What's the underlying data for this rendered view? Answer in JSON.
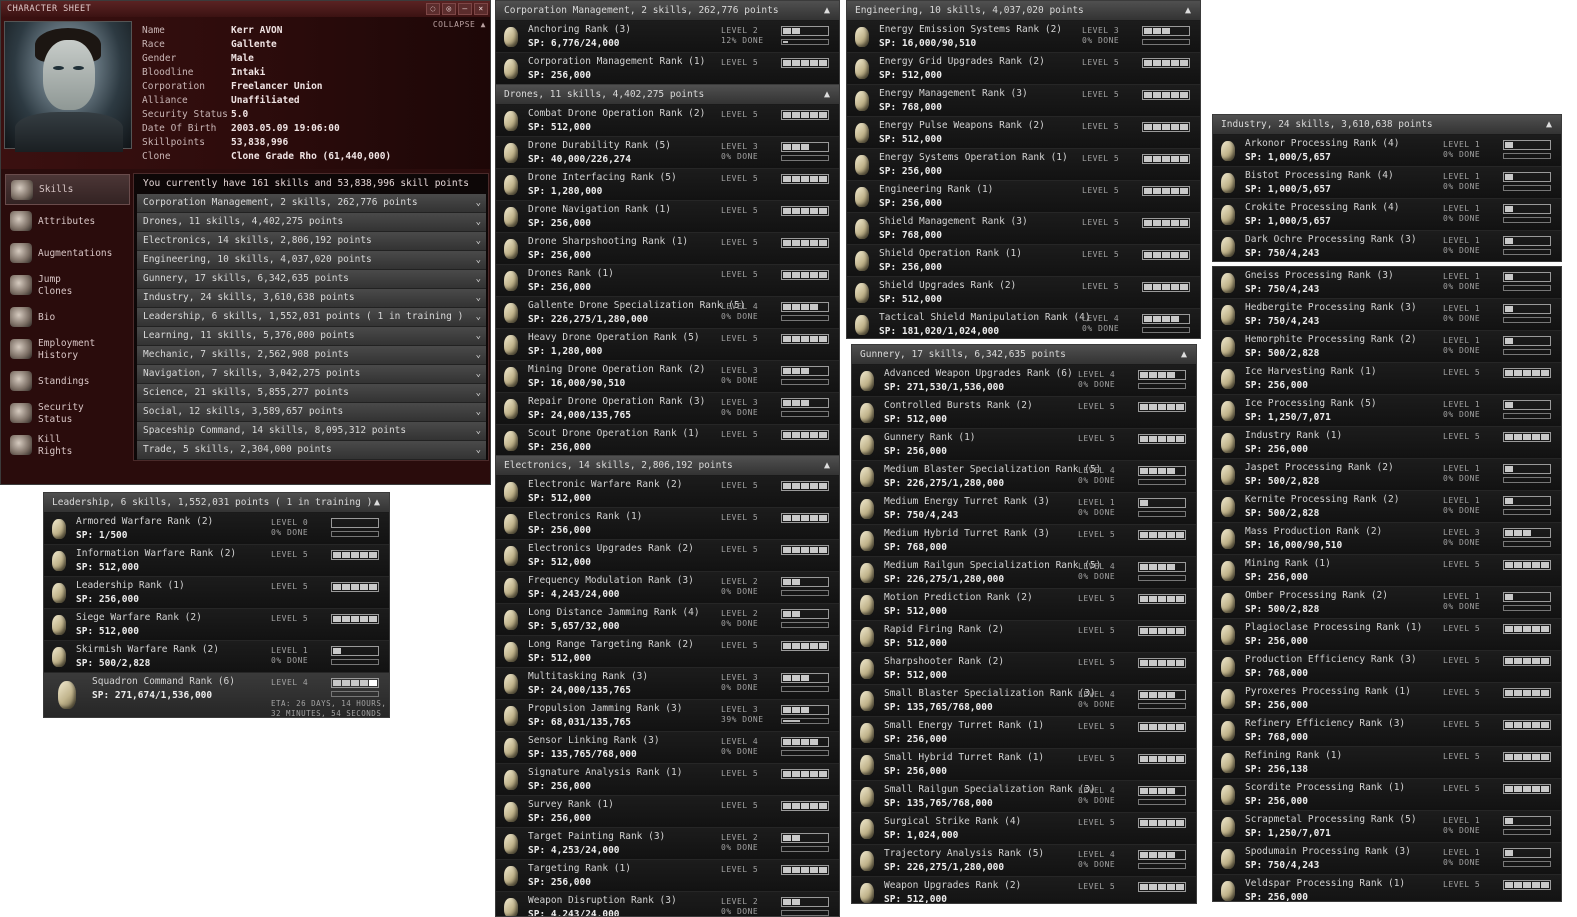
{
  "charsheet": {
    "title": "CHARACTER SHEET",
    "collapse": "COLLAPSE",
    "window_buttons": [
      "◌",
      "◎",
      "–",
      "×"
    ],
    "info": [
      {
        "k": "Name",
        "v": "Kerr AVON"
      },
      {
        "k": "Race",
        "v": "Gallente"
      },
      {
        "k": "Gender",
        "v": "Male"
      },
      {
        "k": "Bloodline",
        "v": "Intaki"
      },
      {
        "k": "Corporation",
        "v": "Freelancer Union"
      },
      {
        "k": "Alliance",
        "v": "Unaffiliated"
      },
      {
        "k": "Security Status",
        "v": "5.0"
      },
      {
        "k": "Date Of Birth",
        "v": "2003.05.09 19:06:00"
      },
      {
        "k": "Skillpoints",
        "v": "53,838,996"
      },
      {
        "k": "Clone",
        "v": "Clone Grade Rho (61,440,000)"
      }
    ],
    "sidebar": [
      {
        "label": "Skills",
        "icon": "skills-icon",
        "active": true
      },
      {
        "label": "Attributes",
        "icon": "attributes-icon"
      },
      {
        "label": "Augmentations",
        "icon": "augmentations-icon"
      },
      {
        "label": "Jump\nClones",
        "icon": "jump-clones-icon"
      },
      {
        "label": "Bio",
        "icon": "bio-icon"
      },
      {
        "label": "Employment\nHistory",
        "icon": "employment-icon"
      },
      {
        "label": "Standings",
        "icon": "standings-icon"
      },
      {
        "label": "Security\nStatus",
        "icon": "security-icon"
      },
      {
        "label": "Kill\nRights",
        "icon": "kill-rights-icon"
      }
    ],
    "notice": "You currently have 161 skills and 53,838,996 skill points",
    "groups": [
      "Corporation Management, 2 skills, 262,776 points",
      "Drones, 11 skills, 4,402,275 points",
      "Electronics, 14 skills, 2,806,192 points",
      "Engineering, 10 skills, 4,037,020 points",
      "Gunnery, 17 skills, 6,342,635 points",
      "Industry, 24 skills, 3,610,638 points",
      "Leadership, 6 skills, 1,552,031 points ( 1 in training )",
      "Learning, 11 skills, 5,376,000 points",
      "Mechanic, 7 skills, 2,562,908 points",
      "Navigation, 7 skills, 3,042,275 points",
      "Science, 21 skills, 5,855,277 points",
      "Social, 12 skills, 3,589,657 points",
      "Spaceship Command, 14 skills, 8,095,312 points",
      "Trade, 5 skills, 2,304,000 points"
    ]
  },
  "panels": [
    {
      "id": "leadership",
      "title": "Leadership, 6 skills, 1,552,031 points ( 1 in training )",
      "skills": [
        {
          "name": "Armored Warfare Rank (2)",
          "sp": "SP: 1/500",
          "level": 0,
          "done": "0% DONE",
          "progress": 0.0
        },
        {
          "name": "Information Warfare Rank (2)",
          "sp": "SP: 512,000",
          "level": 5
        },
        {
          "name": "Leadership Rank (1)",
          "sp": "SP: 256,000",
          "level": 5
        },
        {
          "name": "Siege Warfare Rank (2)",
          "sp": "SP: 512,000",
          "level": 5
        },
        {
          "name": "Skirmish Warfare Rank (2)",
          "sp": "SP: 500/2,828",
          "level": 1,
          "done": "0% DONE",
          "progress": 0.0
        },
        {
          "name": "Squadron Command Rank (6)",
          "sp": "SP: 271,674/1,536,000",
          "level": 4,
          "training": true,
          "eta": "ETA: 26 DAYS, 14 HOURS,",
          "eta2": "32 MINUTES, 54 SECONDS"
        }
      ]
    },
    {
      "id": "corpmgmt",
      "title": "Corporation Management, 2 skills, 262,776 points",
      "skills": [
        {
          "name": "Anchoring Rank (3)",
          "sp": "SP: 6,776/24,000",
          "level": 2,
          "done": "12% DONE",
          "progress": 0.12
        },
        {
          "name": "Corporation Management Rank (1)",
          "sp": "SP: 256,000",
          "level": 5
        }
      ]
    },
    {
      "id": "drones",
      "title": "Drones, 11 skills, 4,402,275 points",
      "skills": [
        {
          "name": "Combat Drone Operation Rank (2)",
          "sp": "SP: 512,000",
          "level": 5
        },
        {
          "name": "Drone Durability Rank (5)",
          "sp": "SP: 40,000/226,274",
          "level": 3,
          "done": "0% DONE",
          "progress": 0.0
        },
        {
          "name": "Drone Interfacing Rank (5)",
          "sp": "SP: 1,280,000",
          "level": 5
        },
        {
          "name": "Drone Navigation Rank (1)",
          "sp": "SP: 256,000",
          "level": 5
        },
        {
          "name": "Drone Sharpshooting Rank (1)",
          "sp": "SP: 256,000",
          "level": 5
        },
        {
          "name": "Drones Rank (1)",
          "sp": "SP: 256,000",
          "level": 5
        },
        {
          "name": "Gallente Drone Specialization Rank (5)",
          "sp": "SP: 226,275/1,280,000",
          "level": 4,
          "done": "0% DONE",
          "progress": 0.0
        },
        {
          "name": "Heavy Drone Operation Rank (5)",
          "sp": "SP: 1,280,000",
          "level": 5
        },
        {
          "name": "Mining Drone Operation Rank (2)",
          "sp": "SP: 16,000/90,510",
          "level": 3,
          "done": "0% DONE",
          "progress": 0.0
        },
        {
          "name": "Repair Drone Operation Rank (3)",
          "sp": "SP: 24,000/135,765",
          "level": 3,
          "done": "0% DONE",
          "progress": 0.0
        },
        {
          "name": "Scout Drone Operation Rank (1)",
          "sp": "SP: 256,000",
          "level": 5
        }
      ]
    },
    {
      "id": "electronics",
      "title": "Electronics, 14 skills, 2,806,192 points",
      "skills": [
        {
          "name": "Electronic Warfare Rank (2)",
          "sp": "SP: 512,000",
          "level": 5
        },
        {
          "name": "Electronics Rank (1)",
          "sp": "SP: 256,000",
          "level": 5
        },
        {
          "name": "Electronics Upgrades Rank (2)",
          "sp": "SP: 512,000",
          "level": 5
        },
        {
          "name": "Frequency Modulation Rank (3)",
          "sp": "SP: 4,243/24,000",
          "level": 2,
          "done": "0% DONE",
          "progress": 0.0
        },
        {
          "name": "Long Distance Jamming Rank (4)",
          "sp": "SP: 5,657/32,000",
          "level": 2,
          "done": "0% DONE",
          "progress": 0.0
        },
        {
          "name": "Long Range Targeting Rank (2)",
          "sp": "SP: 512,000",
          "level": 5
        },
        {
          "name": "Multitasking Rank (3)",
          "sp": "SP: 24,000/135,765",
          "level": 3,
          "done": "0% DONE",
          "progress": 0.0
        },
        {
          "name": "Propulsion Jamming Rank (3)",
          "sp": "SP: 68,031/135,765",
          "level": 3,
          "done": "39% DONE",
          "progress": 0.39
        },
        {
          "name": "Sensor Linking Rank (3)",
          "sp": "SP: 135,765/768,000",
          "level": 4,
          "done": "0% DONE",
          "progress": 0.0
        },
        {
          "name": "Signature Analysis Rank (1)",
          "sp": "SP: 256,000",
          "level": 5
        },
        {
          "name": "Survey Rank (1)",
          "sp": "SP: 256,000",
          "level": 5
        },
        {
          "name": "Target Painting Rank (3)",
          "sp": "SP: 4,253/24,000",
          "level": 2,
          "done": "0% DONE",
          "progress": 0.0
        },
        {
          "name": "Targeting Rank (1)",
          "sp": "SP: 256,000",
          "level": 5
        },
        {
          "name": "Weapon Disruption Rank (3)",
          "sp": "SP: 4,243/24,000",
          "level": 2,
          "done": "0% DONE",
          "progress": 0.0
        }
      ]
    },
    {
      "id": "engineering",
      "title": "Engineering, 10 skills, 4,037,020 points",
      "skills": [
        {
          "name": "Energy Emission Systems Rank (2)",
          "sp": "SP: 16,000/90,510",
          "level": 3,
          "done": "0% DONE",
          "progress": 0.0
        },
        {
          "name": "Energy Grid Upgrades Rank (2)",
          "sp": "SP: 512,000",
          "level": 5
        },
        {
          "name": "Energy Management Rank (3)",
          "sp": "SP: 768,000",
          "level": 5
        },
        {
          "name": "Energy Pulse Weapons Rank (2)",
          "sp": "SP: 512,000",
          "level": 5
        },
        {
          "name": "Energy Systems Operation Rank (1)",
          "sp": "SP: 256,000",
          "level": 5
        },
        {
          "name": "Engineering Rank (1)",
          "sp": "SP: 256,000",
          "level": 5
        },
        {
          "name": "Shield Management Rank (3)",
          "sp": "SP: 768,000",
          "level": 5
        },
        {
          "name": "Shield Operation Rank (1)",
          "sp": "SP: 256,000",
          "level": 5
        },
        {
          "name": "Shield Upgrades Rank (2)",
          "sp": "SP: 512,000",
          "level": 5
        },
        {
          "name": "Tactical Shield Manipulation Rank (4)",
          "sp": "SP: 181,020/1,024,000",
          "level": 4,
          "done": "0% DONE",
          "progress": 0.0
        }
      ]
    },
    {
      "id": "gunnery",
      "title": "Gunnery, 17 skills, 6,342,635 points",
      "skills": [
        {
          "name": "Advanced Weapon Upgrades Rank (6)",
          "sp": "SP: 271,530/1,536,000",
          "level": 4,
          "done": "0% DONE",
          "progress": 0.0
        },
        {
          "name": "Controlled Bursts Rank (2)",
          "sp": "SP: 512,000",
          "level": 5
        },
        {
          "name": "Gunnery Rank (1)",
          "sp": "SP: 256,000",
          "level": 5
        },
        {
          "name": "Medium Blaster Specialization Rank (5)",
          "sp": "SP: 226,275/1,280,000",
          "level": 4,
          "done": "0% DONE",
          "progress": 0.0
        },
        {
          "name": "Medium Energy Turret Rank (3)",
          "sp": "SP: 750/4,243",
          "level": 1,
          "done": "0% DONE",
          "progress": 0.0
        },
        {
          "name": "Medium Hybrid Turret Rank (3)",
          "sp": "SP: 768,000",
          "level": 5
        },
        {
          "name": "Medium Railgun Specialization Rank (5)",
          "sp": "SP: 226,275/1,280,000",
          "level": 4,
          "done": "0% DONE",
          "progress": 0.0
        },
        {
          "name": "Motion Prediction Rank (2)",
          "sp": "SP: 512,000",
          "level": 5
        },
        {
          "name": "Rapid Firing Rank (2)",
          "sp": "SP: 512,000",
          "level": 5
        },
        {
          "name": "Sharpshooter Rank (2)",
          "sp": "SP: 512,000",
          "level": 5
        },
        {
          "name": "Small Blaster Specialization Rank (3)",
          "sp": "SP: 135,765/768,000",
          "level": 4,
          "done": "0% DONE",
          "progress": 0.0
        },
        {
          "name": "Small Energy Turret Rank (1)",
          "sp": "SP: 256,000",
          "level": 5
        },
        {
          "name": "Small Hybrid Turret Rank (1)",
          "sp": "SP: 256,000",
          "level": 5
        },
        {
          "name": "Small Railgun Specialization Rank (3)",
          "sp": "SP: 135,765/768,000",
          "level": 4,
          "done": "0% DONE",
          "progress": 0.0
        },
        {
          "name": "Surgical Strike Rank (4)",
          "sp": "SP: 1,024,000",
          "level": 5
        },
        {
          "name": "Trajectory Analysis Rank (5)",
          "sp": "SP: 226,275/1,280,000",
          "level": 4,
          "done": "0% DONE",
          "progress": 0.0
        },
        {
          "name": "Weapon Upgrades Rank (2)",
          "sp": "SP: 512,000",
          "level": 5
        }
      ]
    },
    {
      "id": "industry",
      "title": "Industry, 24 skills, 3,610,638 points",
      "skills": [
        {
          "name": "Arkonor Processing Rank (4)",
          "sp": "SP: 1,000/5,657",
          "level": 1,
          "done": "0% DONE",
          "progress": 0.0
        },
        {
          "name": "Bistot Processing Rank (4)",
          "sp": "SP: 1,000/5,657",
          "level": 1,
          "done": "0% DONE",
          "progress": 0.0
        },
        {
          "name": "Crokite Processing Rank (4)",
          "sp": "SP: 1,000/5,657",
          "level": 1,
          "done": "0% DONE",
          "progress": 0.0
        },
        {
          "name": "Dark Ochre Processing Rank (3)",
          "sp": "SP: 750/4,243",
          "level": 1,
          "done": "0% DONE",
          "progress": 0.0
        }
      ]
    },
    {
      "id": "industry2",
      "title": "",
      "skills": [
        {
          "name": "Gneiss Processing Rank (3)",
          "sp": "SP: 750/4,243",
          "level": 1,
          "done": "0% DONE",
          "progress": 0.0
        },
        {
          "name": "Hedbergite Processing Rank (3)",
          "sp": "SP: 750/4,243",
          "level": 1,
          "done": "0% DONE",
          "progress": 0.0
        },
        {
          "name": "Hemorphite Processing Rank (2)",
          "sp": "SP: 500/2,828",
          "level": 1,
          "done": "0% DONE",
          "progress": 0.0
        },
        {
          "name": "Ice Harvesting Rank (1)",
          "sp": "SP: 256,000",
          "level": 5
        },
        {
          "name": "Ice Processing Rank (5)",
          "sp": "SP: 1,250/7,071",
          "level": 1,
          "done": "0% DONE",
          "progress": 0.0
        },
        {
          "name": "Industry Rank (1)",
          "sp": "SP: 256,000",
          "level": 5
        },
        {
          "name": "Jaspet Processing Rank (2)",
          "sp": "SP: 500/2,828",
          "level": 1,
          "done": "0% DONE",
          "progress": 0.0
        },
        {
          "name": "Kernite Processing Rank (2)",
          "sp": "SP: 500/2,828",
          "level": 1,
          "done": "0% DONE",
          "progress": 0.0
        },
        {
          "name": "Mass Production Rank (2)",
          "sp": "SP: 16,000/90,510",
          "level": 3,
          "done": "0% DONE",
          "progress": 0.0
        },
        {
          "name": "Mining Rank (1)",
          "sp": "SP: 256,000",
          "level": 5
        },
        {
          "name": "Omber Processing Rank (2)",
          "sp": "SP: 500/2,828",
          "level": 1,
          "done": "0% DONE",
          "progress": 0.0
        },
        {
          "name": "Plagioclase Processing Rank (1)",
          "sp": "SP: 256,000",
          "level": 5
        },
        {
          "name": "Production Efficiency Rank (3)",
          "sp": "SP: 768,000",
          "level": 5
        },
        {
          "name": "Pyroxeres Processing Rank (1)",
          "sp": "SP: 256,000",
          "level": 5
        },
        {
          "name": "Refinery Efficiency Rank (3)",
          "sp": "SP: 768,000",
          "level": 5
        },
        {
          "name": "Refining Rank (1)",
          "sp": "SP: 256,138",
          "level": 5
        },
        {
          "name": "Scordite Processing Rank (1)",
          "sp": "SP: 256,000",
          "level": 5
        },
        {
          "name": "Scrapmetal Processing Rank (5)",
          "sp": "SP: 1,250/7,071",
          "level": 1,
          "done": "0% DONE",
          "progress": 0.0
        },
        {
          "name": "Spodumain Processing Rank (3)",
          "sp": "SP: 750/4,243",
          "level": 1,
          "done": "0% DONE",
          "progress": 0.0
        },
        {
          "name": "Veldspar Processing Rank (1)",
          "sp": "SP: 256,000",
          "level": 5
        }
      ]
    }
  ],
  "labels": {
    "level_prefix": "LEVEL"
  }
}
